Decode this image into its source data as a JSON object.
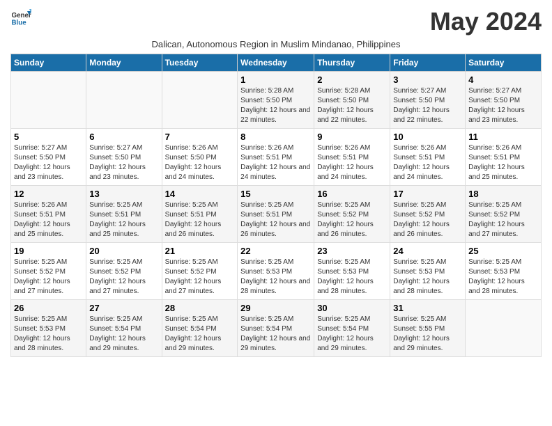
{
  "logo": {
    "general": "General",
    "blue": "Blue"
  },
  "title": "May 2024",
  "subtitle": "Dalican, Autonomous Region in Muslim Mindanao, Philippines",
  "headers": [
    "Sunday",
    "Monday",
    "Tuesday",
    "Wednesday",
    "Thursday",
    "Friday",
    "Saturday"
  ],
  "weeks": [
    [
      {
        "day": "",
        "info": ""
      },
      {
        "day": "",
        "info": ""
      },
      {
        "day": "",
        "info": ""
      },
      {
        "day": "1",
        "info": "Sunrise: 5:28 AM\nSunset: 5:50 PM\nDaylight: 12 hours and 22 minutes."
      },
      {
        "day": "2",
        "info": "Sunrise: 5:28 AM\nSunset: 5:50 PM\nDaylight: 12 hours and 22 minutes."
      },
      {
        "day": "3",
        "info": "Sunrise: 5:27 AM\nSunset: 5:50 PM\nDaylight: 12 hours and 22 minutes."
      },
      {
        "day": "4",
        "info": "Sunrise: 5:27 AM\nSunset: 5:50 PM\nDaylight: 12 hours and 23 minutes."
      }
    ],
    [
      {
        "day": "5",
        "info": "Sunrise: 5:27 AM\nSunset: 5:50 PM\nDaylight: 12 hours and 23 minutes."
      },
      {
        "day": "6",
        "info": "Sunrise: 5:27 AM\nSunset: 5:50 PM\nDaylight: 12 hours and 23 minutes."
      },
      {
        "day": "7",
        "info": "Sunrise: 5:26 AM\nSunset: 5:50 PM\nDaylight: 12 hours and 24 minutes."
      },
      {
        "day": "8",
        "info": "Sunrise: 5:26 AM\nSunset: 5:51 PM\nDaylight: 12 hours and 24 minutes."
      },
      {
        "day": "9",
        "info": "Sunrise: 5:26 AM\nSunset: 5:51 PM\nDaylight: 12 hours and 24 minutes."
      },
      {
        "day": "10",
        "info": "Sunrise: 5:26 AM\nSunset: 5:51 PM\nDaylight: 12 hours and 24 minutes."
      },
      {
        "day": "11",
        "info": "Sunrise: 5:26 AM\nSunset: 5:51 PM\nDaylight: 12 hours and 25 minutes."
      }
    ],
    [
      {
        "day": "12",
        "info": "Sunrise: 5:26 AM\nSunset: 5:51 PM\nDaylight: 12 hours and 25 minutes."
      },
      {
        "day": "13",
        "info": "Sunrise: 5:25 AM\nSunset: 5:51 PM\nDaylight: 12 hours and 25 minutes."
      },
      {
        "day": "14",
        "info": "Sunrise: 5:25 AM\nSunset: 5:51 PM\nDaylight: 12 hours and 26 minutes."
      },
      {
        "day": "15",
        "info": "Sunrise: 5:25 AM\nSunset: 5:51 PM\nDaylight: 12 hours and 26 minutes."
      },
      {
        "day": "16",
        "info": "Sunrise: 5:25 AM\nSunset: 5:52 PM\nDaylight: 12 hours and 26 minutes."
      },
      {
        "day": "17",
        "info": "Sunrise: 5:25 AM\nSunset: 5:52 PM\nDaylight: 12 hours and 26 minutes."
      },
      {
        "day": "18",
        "info": "Sunrise: 5:25 AM\nSunset: 5:52 PM\nDaylight: 12 hours and 27 minutes."
      }
    ],
    [
      {
        "day": "19",
        "info": "Sunrise: 5:25 AM\nSunset: 5:52 PM\nDaylight: 12 hours and 27 minutes."
      },
      {
        "day": "20",
        "info": "Sunrise: 5:25 AM\nSunset: 5:52 PM\nDaylight: 12 hours and 27 minutes."
      },
      {
        "day": "21",
        "info": "Sunrise: 5:25 AM\nSunset: 5:52 PM\nDaylight: 12 hours and 27 minutes."
      },
      {
        "day": "22",
        "info": "Sunrise: 5:25 AM\nSunset: 5:53 PM\nDaylight: 12 hours and 28 minutes."
      },
      {
        "day": "23",
        "info": "Sunrise: 5:25 AM\nSunset: 5:53 PM\nDaylight: 12 hours and 28 minutes."
      },
      {
        "day": "24",
        "info": "Sunrise: 5:25 AM\nSunset: 5:53 PM\nDaylight: 12 hours and 28 minutes."
      },
      {
        "day": "25",
        "info": "Sunrise: 5:25 AM\nSunset: 5:53 PM\nDaylight: 12 hours and 28 minutes."
      }
    ],
    [
      {
        "day": "26",
        "info": "Sunrise: 5:25 AM\nSunset: 5:53 PM\nDaylight: 12 hours and 28 minutes."
      },
      {
        "day": "27",
        "info": "Sunrise: 5:25 AM\nSunset: 5:54 PM\nDaylight: 12 hours and 29 minutes."
      },
      {
        "day": "28",
        "info": "Sunrise: 5:25 AM\nSunset: 5:54 PM\nDaylight: 12 hours and 29 minutes."
      },
      {
        "day": "29",
        "info": "Sunrise: 5:25 AM\nSunset: 5:54 PM\nDaylight: 12 hours and 29 minutes."
      },
      {
        "day": "30",
        "info": "Sunrise: 5:25 AM\nSunset: 5:54 PM\nDaylight: 12 hours and 29 minutes."
      },
      {
        "day": "31",
        "info": "Sunrise: 5:25 AM\nSunset: 5:55 PM\nDaylight: 12 hours and 29 minutes."
      },
      {
        "day": "",
        "info": ""
      }
    ]
  ]
}
